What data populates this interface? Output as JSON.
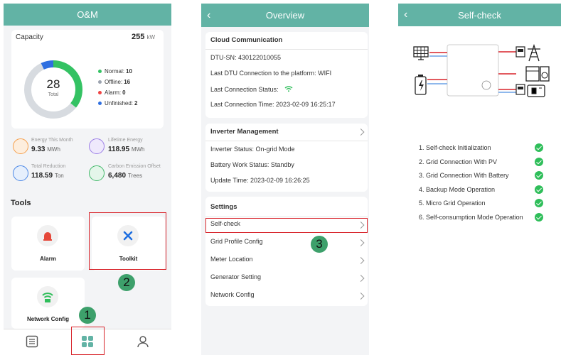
{
  "screen1": {
    "title": "O&M",
    "capacity": {
      "label": "Capacity",
      "value": "255",
      "unit": "kW"
    },
    "donut": {
      "total": "28",
      "total_label": "Total",
      "segments": [
        {
          "name": "Normal",
          "value": 10,
          "color": "#34c263"
        },
        {
          "name": "Offline",
          "value": 16,
          "color": "#d7dbe0"
        },
        {
          "name": "Alarm",
          "value": 0,
          "color": "#ef4444"
        },
        {
          "name": "Unfinished",
          "value": 2,
          "color": "#2f6fe0"
        }
      ]
    },
    "legend": [
      {
        "label": "Normal:",
        "value": "10",
        "color": "#34c263"
      },
      {
        "label": "Offline:",
        "value": "16",
        "color": "#9ca3af"
      },
      {
        "label": "Alarm:",
        "value": "0",
        "color": "#ef4444"
      },
      {
        "label": "Unfinished:",
        "value": "2",
        "color": "#2f6fe0"
      }
    ],
    "metrics": [
      {
        "label": "Energy This Month",
        "value": "9.33",
        "unit": "MWh",
        "icon": "calendar-icon",
        "color": "#f6a04d"
      },
      {
        "label": "Lifetime Energy",
        "value": "118.95",
        "unit": "MWh",
        "icon": "all-energy-icon",
        "color": "#9b7ee6"
      },
      {
        "label": "Total Reduction",
        "value": "118.59",
        "unit": "Ton",
        "icon": "reduction-icon",
        "color": "#4a87e6"
      },
      {
        "label": "Carbon Emission Offset",
        "value": "6,480",
        "unit": "Trees",
        "icon": "tree-icon",
        "color": "#43b86a"
      }
    ],
    "tools_title": "Tools",
    "tools": [
      {
        "label": "Alarm",
        "icon": "alarm-icon"
      },
      {
        "label": "Toolkit",
        "icon": "toolkit-icon"
      },
      {
        "label": "Network Config",
        "icon": "network-config-icon"
      }
    ],
    "badges": [
      "1",
      "2"
    ]
  },
  "screen2": {
    "title": "Overview",
    "cloud": {
      "title": "Cloud Communication",
      "dtu_sn": "DTU-SN: 430122010055",
      "last_dtu": "Last DTU Connection to the platform: WIFI",
      "last_status": "Last Connection Status:",
      "last_time": "Last Connection Time: 2023-02-09 16:25:17"
    },
    "inverter": {
      "title": "Inverter Management",
      "status": "Inverter Status: On-grid Mode",
      "battery": "Battery Work Status: Standby",
      "update": "Update Time: 2023-02-09 16:26:25"
    },
    "settings": {
      "title": "Settings",
      "items": [
        "Self-check",
        "Grid Profile Config",
        "Meter Location",
        "Generator Setting",
        "Network Config"
      ]
    },
    "badge": "3"
  },
  "screen3": {
    "title": "Self-check",
    "checks": [
      "1. Self-check Initialization",
      "2. Grid Connection With PV",
      "3. Grid Connection With Battery",
      "4. Backup Mode Operation",
      "5. Micro Grid Operation",
      "6. Self-consumption Mode Operation"
    ],
    "colors": {
      "accent": "#62b3a5",
      "ok": "#2fbe5a",
      "highlight": "#d8232a"
    }
  }
}
